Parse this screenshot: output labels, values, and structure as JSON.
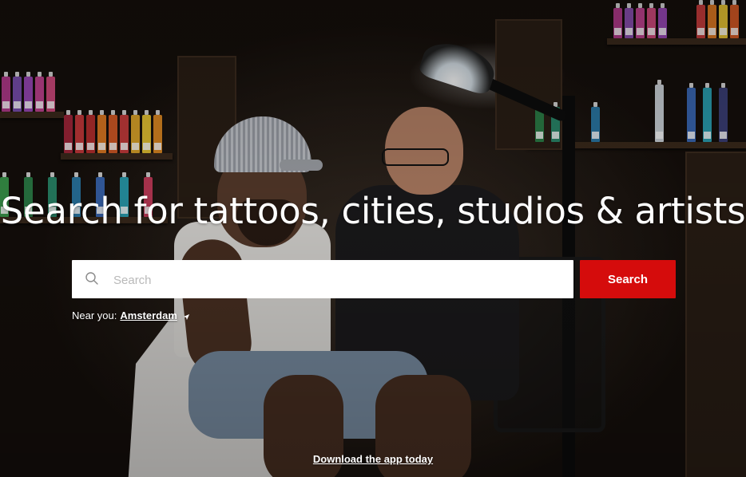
{
  "hero": {
    "headline": "Search for tattoos, cities, studios & artists"
  },
  "search": {
    "placeholder": "Search",
    "button_label": "Search"
  },
  "location": {
    "prefix": "Near you:",
    "city": "Amsterdam"
  },
  "footer": {
    "download_app_label": "Download the app today"
  },
  "colors": {
    "accent": "#d50c0c",
    "text": "#ffffff"
  },
  "icons": {
    "search": "search-icon",
    "location": "location-arrow-icon"
  }
}
